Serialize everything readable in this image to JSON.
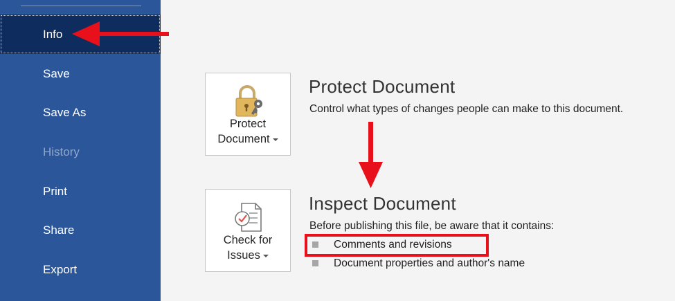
{
  "sidebar": {
    "items": [
      {
        "label": "Info",
        "state": "active"
      },
      {
        "label": "Save",
        "state": "normal"
      },
      {
        "label": "Save As",
        "state": "normal"
      },
      {
        "label": "History",
        "state": "disabled"
      },
      {
        "label": "Print",
        "state": "normal"
      },
      {
        "label": "Share",
        "state": "normal"
      },
      {
        "label": "Export",
        "state": "normal"
      }
    ]
  },
  "protect": {
    "tile_line1": "Protect",
    "tile_line2": "Document",
    "heading": "Protect Document",
    "description": "Control what types of changes people can make to this document."
  },
  "inspect": {
    "tile_line1": "Check for",
    "tile_line2": "Issues",
    "heading": "Inspect Document",
    "description": "Before publishing this file, be aware that it contains:",
    "items": [
      "Comments and revisions",
      "Document properties and author's name"
    ]
  },
  "icons": {
    "protect": "padlock-with-key-icon",
    "inspect": "document-checklist-icon"
  },
  "colors": {
    "sidebar": "#2b579a",
    "sidebar_active": "#0e2c5e",
    "annotation": "#e8101a",
    "background": "#f4f4f4"
  }
}
